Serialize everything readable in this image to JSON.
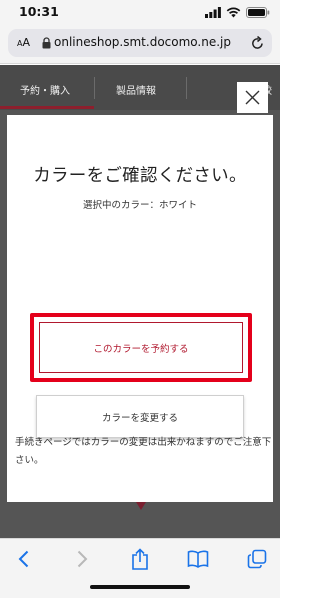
{
  "status_bar": {
    "time": "10:31"
  },
  "browser": {
    "text_size_label": "AA",
    "url": "onlineshop.smt.docomo.ne.jp"
  },
  "page": {
    "tabs": [
      {
        "label": "予約・購入"
      },
      {
        "label": "製品情報"
      },
      {
        "label": "比較"
      }
    ]
  },
  "modal": {
    "title": "カラーをご確認ください。",
    "selected_color": "選択中のカラー：ホワイト",
    "reserve_button_label": "このカラーを予約する",
    "change_button_label": "カラーを変更する",
    "notice": "手続きページではカラーの変更は出来かねますのでご注意下さい。",
    "highlight_color": "#e4001b",
    "accent_color": "#b0182e"
  },
  "toolbar": {
    "icons": [
      "back-icon",
      "forward-icon",
      "share-icon",
      "bookmarks-icon",
      "tabs-icon"
    ]
  }
}
